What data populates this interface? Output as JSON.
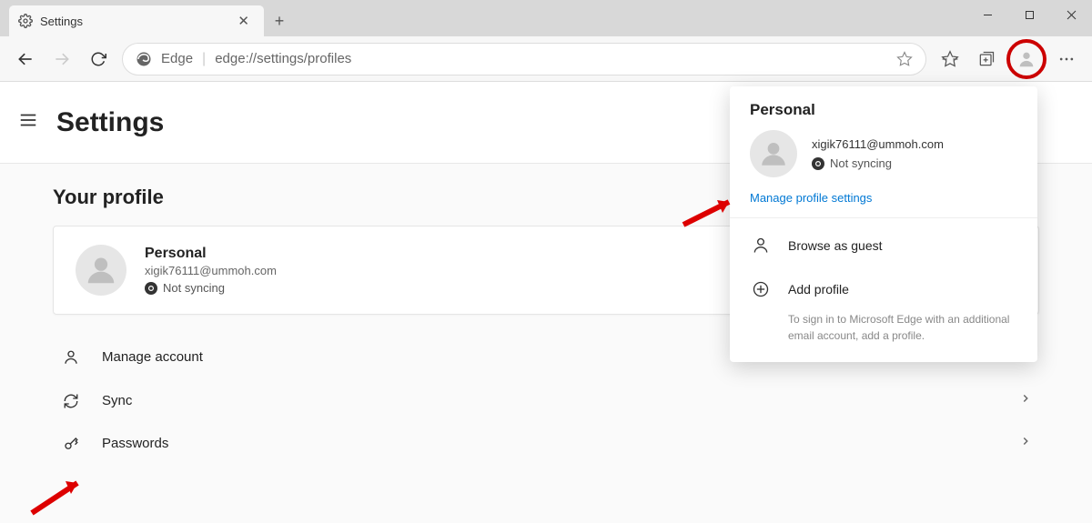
{
  "window": {
    "tab_title": "Settings",
    "minimize": "—",
    "maximize": "☐",
    "close": "✕"
  },
  "toolbar": {
    "brand": "Edge",
    "url": "edge://settings/profiles"
  },
  "header": {
    "title": "Settings"
  },
  "profile_section": {
    "heading": "Your profile",
    "card": {
      "name": "Personal",
      "email": "xigik76111@ummoh.com",
      "sync_status": "Not syncing"
    },
    "rows": [
      {
        "icon": "person",
        "label": "Manage account",
        "trailing": "external"
      },
      {
        "icon": "sync",
        "label": "Sync",
        "trailing": "chevron"
      },
      {
        "icon": "key",
        "label": "Passwords",
        "trailing": "chevron"
      }
    ]
  },
  "flyout": {
    "title": "Personal",
    "email": "xigik76111@ummoh.com",
    "sync_status": "Not syncing",
    "manage_link": "Manage profile settings",
    "browse_guest": "Browse as guest",
    "add_profile": "Add profile",
    "add_profile_hint": "To sign in to Microsoft Edge with an additional email account, add a profile."
  }
}
